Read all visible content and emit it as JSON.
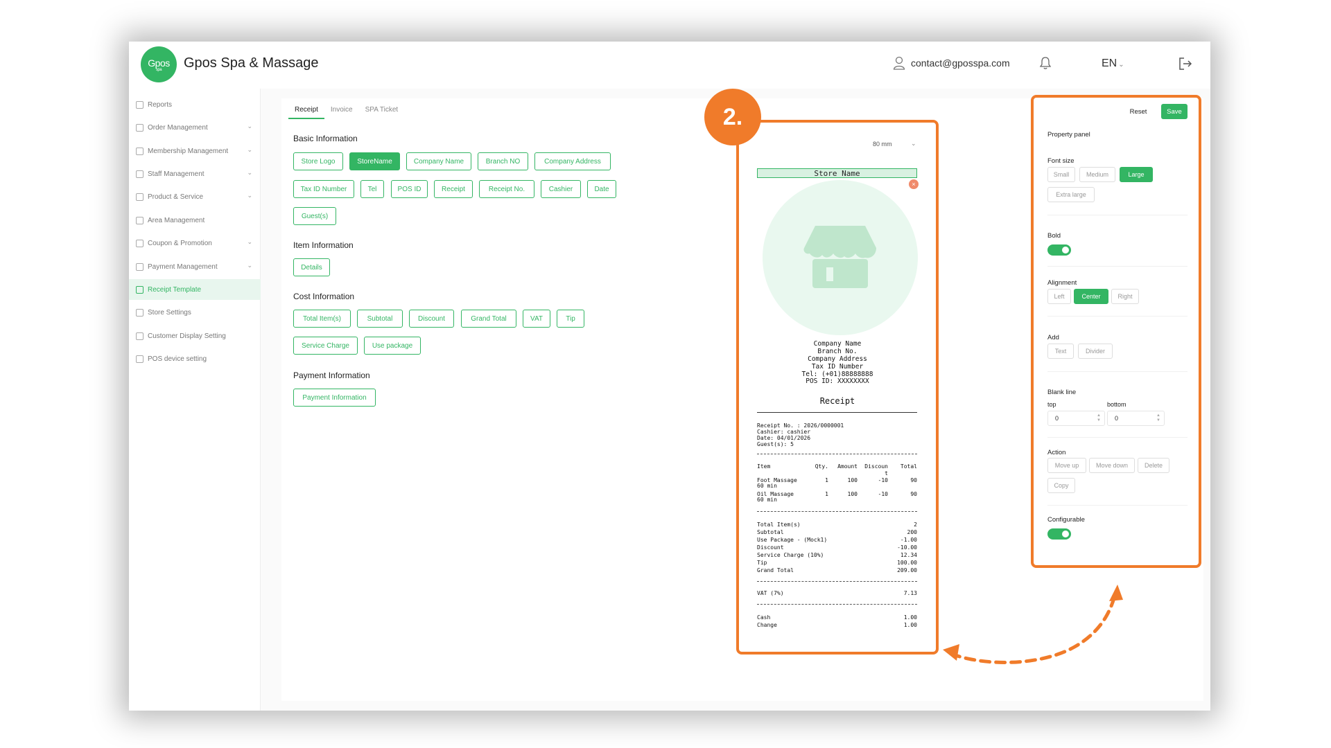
{
  "app": {
    "logo_text": "Gpos",
    "logo_sub": "spa",
    "title": "Gpos Spa & Massage"
  },
  "header": {
    "email": "contact@gposspa.com",
    "language": "EN"
  },
  "sidebar": {
    "items": [
      {
        "label": "Reports"
      },
      {
        "label": "Order Management"
      },
      {
        "label": "Membership Management"
      },
      {
        "label": "Staff Management"
      },
      {
        "label": "Product & Service"
      },
      {
        "label": "Area Management"
      },
      {
        "label": "Coupon & Promotion"
      },
      {
        "label": "Payment Management"
      },
      {
        "label": "Receipt Template"
      },
      {
        "label": "Store Settings"
      },
      {
        "label": "Customer Display Setting"
      },
      {
        "label": "POS device setting"
      }
    ]
  },
  "tabs": [
    "Receipt",
    "Invoice",
    "SPA Ticket"
  ],
  "sections": {
    "basic": {
      "title": "Basic Information",
      "chips": [
        "Store Logo",
        "StoreName",
        "Company Name",
        "Branch NO",
        "Company Address",
        "Tax ID Number",
        "Tel",
        "POS ID",
        "Receipt",
        "Receipt No.",
        "Cashier",
        "Date",
        "Guest(s)"
      ]
    },
    "item": {
      "title": "Item Information",
      "chips": [
        "Details"
      ]
    },
    "cost": {
      "title": "Cost Information",
      "chips": [
        "Total Item(s)",
        "Subtotal",
        "Discount",
        "Grand Total",
        "VAT",
        "Tip",
        "Service Charge",
        "Use package"
      ]
    },
    "payment": {
      "title": "Payment Information",
      "chips": [
        "Payment Information"
      ]
    }
  },
  "step_badge": "2.",
  "receipt": {
    "paper_size": "80 mm",
    "store_name": "Store Name",
    "close": "×",
    "company_lines": [
      "Company Name",
      "Branch No.",
      "Company Address",
      "Tax ID Number",
      "Tel: (+01)88888888",
      "POS ID: XXXXXXXX"
    ],
    "title": "Receipt",
    "meta_lines": [
      "Receipt No. : 2026/0000001",
      "Cashier: cashier",
      "Date: 04/01/2026",
      "Guest(s): 5"
    ],
    "headers": {
      "item": "Item",
      "qty": "Qty.",
      "amount": "Amount",
      "discount": "Discoun\nt",
      "total": "Total"
    },
    "items": [
      {
        "name": "Foot Massage",
        "sub": "60 min",
        "qty": "1",
        "amount": "100",
        "discount": "-10",
        "total": "90"
      },
      {
        "name": "Oil Massage",
        "sub": "60 min",
        "qty": "1",
        "amount": "100",
        "discount": "-10",
        "total": "90"
      }
    ],
    "totals": [
      {
        "k": "Total Item(s)",
        "v": "2"
      },
      {
        "k": "Subtotal",
        "v": "200"
      },
      {
        "k": "Use Package - (Mock1)",
        "v": "-1.00"
      },
      {
        "k": "Discount",
        "v": "-10.00"
      },
      {
        "k": "Service Charge  (10%)",
        "v": "12.34"
      },
      {
        "k": "Tip",
        "v": "100.00"
      },
      {
        "k": "Grand Total",
        "v": "209.00"
      }
    ],
    "vat": {
      "k": "VAT (7%)",
      "v": "7.13"
    },
    "payments": [
      {
        "k": "Cash",
        "v": "1.00"
      },
      {
        "k": "Change",
        "v": "1.00"
      }
    ]
  },
  "panel": {
    "reset": "Reset",
    "save": "Save",
    "title": "Property panel",
    "font_size": {
      "label": "Font size",
      "options": [
        "Small",
        "Medium",
        "Large",
        "Extra large"
      ],
      "selected": "Large"
    },
    "bold": {
      "label": "Bold",
      "on": true
    },
    "alignment": {
      "label": "Alignment",
      "options": [
        "Left",
        "Center",
        "Right"
      ],
      "selected": "Center"
    },
    "add": {
      "label": "Add",
      "options": [
        "Text",
        "Divider"
      ]
    },
    "blank_line": {
      "label": "Blank line",
      "top_label": "top",
      "bottom_label": "bottom",
      "top_value": "0",
      "bottom_value": "0"
    },
    "action": {
      "label": "Action",
      "options": [
        "Move up",
        "Move down",
        "Delete",
        "Copy"
      ]
    },
    "configurable": {
      "label": "Configurable",
      "on": true
    }
  },
  "colors": {
    "brand": "#33b563",
    "accent": "#f07b2a"
  }
}
